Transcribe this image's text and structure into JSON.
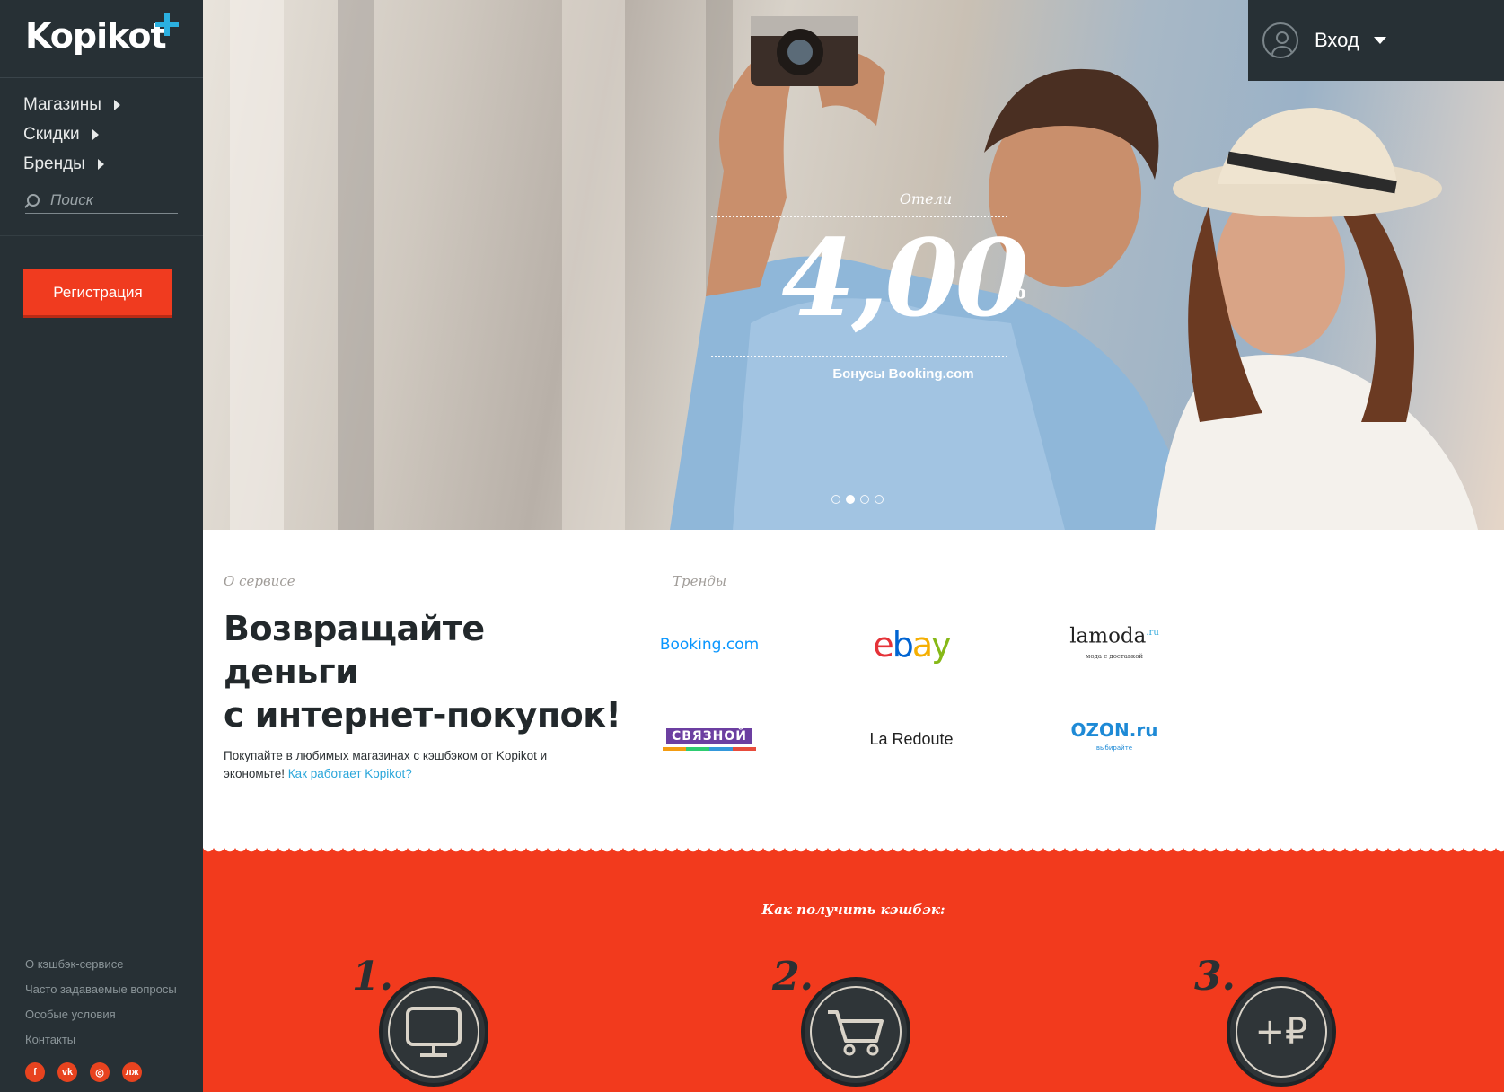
{
  "brand": {
    "name": "Kopikot",
    "accent": "#2bb0e0"
  },
  "sidebar": {
    "nav": [
      {
        "label": "Магазины"
      },
      {
        "label": "Скидки"
      },
      {
        "label": "Бренды"
      }
    ],
    "search_placeholder": "Поиск",
    "register_label": "Регистрация",
    "footer_links": [
      {
        "label": "О кэшбэк-сервисе"
      },
      {
        "label": "Часто задаваемые вопросы"
      },
      {
        "label": "Особые условия"
      },
      {
        "label": "Контакты"
      }
    ],
    "socials": [
      {
        "icon": "facebook-icon",
        "glyph": "f"
      },
      {
        "icon": "vk-icon",
        "glyph": "vk"
      },
      {
        "icon": "instagram-icon",
        "glyph": "◎"
      },
      {
        "icon": "livejournal-icon",
        "glyph": "лж"
      }
    ]
  },
  "login": {
    "label": "Вход"
  },
  "hero": {
    "category": "Отели",
    "value": "4,00",
    "unit": "%",
    "subtitle": "Бонусы  Booking.com",
    "slide_count": 4,
    "active_slide": 2
  },
  "about": {
    "section_label": "О сервисе",
    "headline_lines": [
      "Возвращайте",
      "деньги",
      "с интернет-покупок!"
    ],
    "description": "Покупайте в любимых магазинах с кэшбэком от Kopikot и экономьте!",
    "link_label": "Как работает Kopikot?"
  },
  "trends": {
    "section_label": "Тренды",
    "brands": [
      {
        "name": "Booking",
        "suffix": ".com"
      },
      {
        "name": "ebay"
      },
      {
        "name": "lamoda",
        "sup": ".ru",
        "tagline": "мода с доставкой"
      },
      {
        "name": "СВЯЗНОЙ"
      },
      {
        "name": "La Redoute"
      },
      {
        "name": "OZON.ru",
        "tagline": "выбирайте"
      }
    ]
  },
  "how": {
    "title": "Как получить кэшбэк:",
    "steps": [
      {
        "num": "1.",
        "icon": "monitor-icon"
      },
      {
        "num": "2.",
        "icon": "cart-icon"
      },
      {
        "num": "3.",
        "icon": "plus-ruble-icon",
        "glyph": "+₽"
      }
    ]
  },
  "colors": {
    "sidebar": "#273035",
    "primary_red": "#f03b1f",
    "link": "#2aa6da"
  }
}
